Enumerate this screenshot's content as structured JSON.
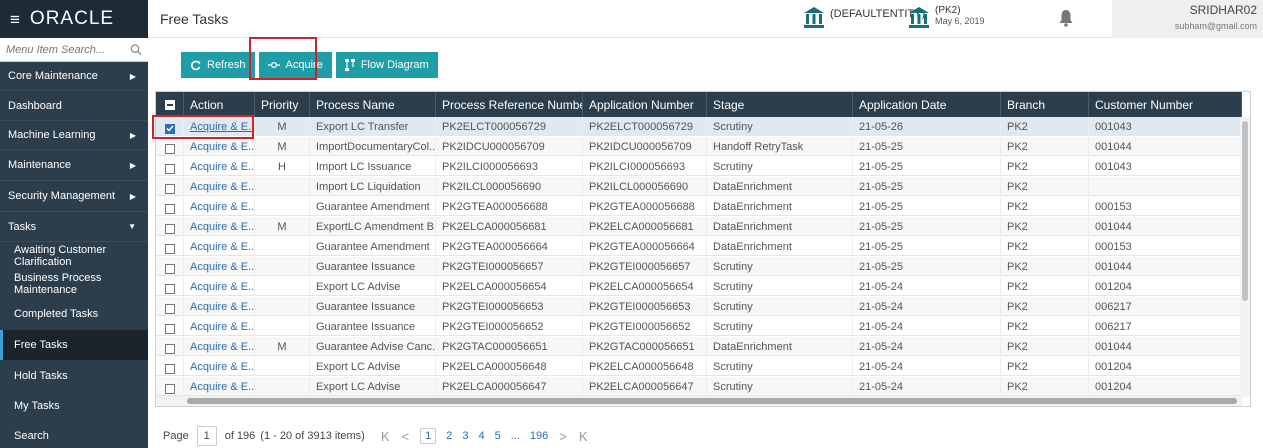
{
  "header": {
    "logo": "ORACLE",
    "page_title": "Free Tasks",
    "entity": "(DEFAULTENTITY)",
    "branch_entity": "(PK2)",
    "branch_date": "May 6, 2019",
    "user_name": "SRIDHAR02",
    "user_email": "subham@gmail.com"
  },
  "sidebar": {
    "search_placeholder": "Menu Item Search...",
    "items": [
      {
        "label": "Core Maintenance",
        "arrow": "▶"
      },
      {
        "label": "Dashboard",
        "arrow": ""
      },
      {
        "label": "Machine Learning",
        "arrow": "▶"
      },
      {
        "label": "Maintenance",
        "arrow": "▶"
      },
      {
        "label": "Security Management",
        "arrow": "▶"
      },
      {
        "label": "Tasks",
        "arrow": "▼"
      }
    ],
    "subitems": [
      {
        "label": "Awaiting Customer Clarification"
      },
      {
        "label": "Business Process Maintenance"
      },
      {
        "label": "Completed Tasks"
      },
      {
        "label": "Free Tasks"
      },
      {
        "label": "Hold Tasks"
      },
      {
        "label": "My Tasks"
      },
      {
        "label": "Search"
      }
    ]
  },
  "toolbar": {
    "refresh": "Refresh",
    "acquire": "Acquire",
    "flow_diagram": "Flow Diagram"
  },
  "grid": {
    "columns": [
      "Action",
      "Priority",
      "Process Name",
      "Process Reference Number",
      "Application Number",
      "Stage",
      "Application Date",
      "Branch",
      "Customer Number"
    ],
    "rows": [
      [
        "Acquire & E...",
        "M",
        "Export LC Transfer",
        "PK2ELCT000056729",
        "PK2ELCT000056729",
        "Scrutiny",
        "21-05-26",
        "PK2",
        "001043"
      ],
      [
        "Acquire & E...",
        "M",
        "ImportDocumentaryCol...",
        "PK2IDCU000056709",
        "PK2IDCU000056709",
        "Handoff RetryTask",
        "21-05-25",
        "PK2",
        "001044"
      ],
      [
        "Acquire & E...",
        "H",
        "Import LC Issuance",
        "PK2ILCI000056693",
        "PK2ILCI000056693",
        "Scrutiny",
        "21-05-25",
        "PK2",
        "001043"
      ],
      [
        "Acquire & E...",
        "",
        "Import LC Liquidation",
        "PK2ILCL000056690",
        "PK2ILCL000056690",
        "DataEnrichment",
        "21-05-25",
        "PK2",
        ""
      ],
      [
        "Acquire & E...",
        "",
        "Guarantee Amendment",
        "PK2GTEA000056688",
        "PK2GTEA000056688",
        "DataEnrichment",
        "21-05-25",
        "PK2",
        "000153"
      ],
      [
        "Acquire & E...",
        "M",
        "ExportLC Amendment B...",
        "PK2ELCA000056681",
        "PK2ELCA000056681",
        "DataEnrichment",
        "21-05-25",
        "PK2",
        "001044"
      ],
      [
        "Acquire & E...",
        "",
        "Guarantee Amendment",
        "PK2GTEA000056664",
        "PK2GTEA000056664",
        "DataEnrichment",
        "21-05-25",
        "PK2",
        "000153"
      ],
      [
        "Acquire & E...",
        "",
        "Guarantee Issuance",
        "PK2GTEI000056657",
        "PK2GTEI000056657",
        "Scrutiny",
        "21-05-25",
        "PK2",
        "001044"
      ],
      [
        "Acquire & E...",
        "",
        "Export LC Advise",
        "PK2ELCA000056654",
        "PK2ELCA000056654",
        "Scrutiny",
        "21-05-24",
        "PK2",
        "001204"
      ],
      [
        "Acquire & E...",
        "",
        "Guarantee Issuance",
        "PK2GTEI000056653",
        "PK2GTEI000056653",
        "Scrutiny",
        "21-05-24",
        "PK2",
        "006217"
      ],
      [
        "Acquire & E...",
        "",
        "Guarantee Issuance",
        "PK2GTEI000056652",
        "PK2GTEI000056652",
        "Scrutiny",
        "21-05-24",
        "PK2",
        "006217"
      ],
      [
        "Acquire & E...",
        "M",
        "Guarantee Advise Canc...",
        "PK2GTAC000056651",
        "PK2GTAC000056651",
        "DataEnrichment",
        "21-05-24",
        "PK2",
        "001044"
      ],
      [
        "Acquire & E...",
        "",
        "Export LC Advise",
        "PK2ELCA000056648",
        "PK2ELCA000056648",
        "Scrutiny",
        "21-05-24",
        "PK2",
        "001204"
      ],
      [
        "Acquire & E...",
        "",
        "Export LC Advise",
        "PK2ELCA000056647",
        "PK2ELCA000056647",
        "Scrutiny",
        "21-05-24",
        "PK2",
        "001204"
      ]
    ],
    "selected_row": 0
  },
  "pager": {
    "page_label": "Page",
    "current_page": "1",
    "of_label": "of 196",
    "items_label": "(1 - 20 of 3913 items)",
    "first": "K",
    "prev": "<",
    "pages": [
      "1",
      "2",
      "3",
      "4",
      "5"
    ],
    "ellipsis": "...",
    "last_page": "196",
    "next": ">",
    "last": "K"
  },
  "colors": {
    "sidebar_bg": "#2c3e4c",
    "header_bg": "#1d2b36",
    "button_teal": "#1f9ea8",
    "highlight_red": "#d61f26",
    "link_blue": "#2b6cb0"
  }
}
